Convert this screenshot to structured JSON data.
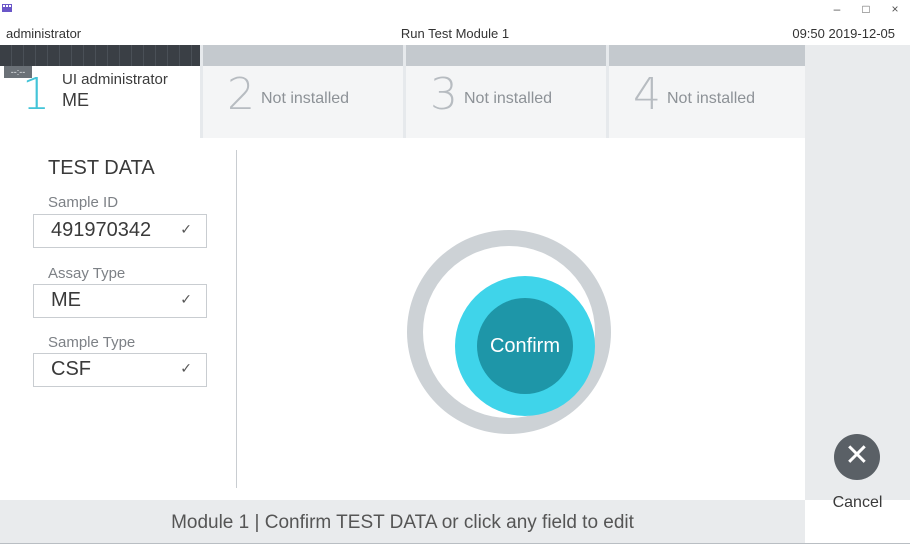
{
  "window": {
    "minimize": "–",
    "maximize": "□",
    "close": "×"
  },
  "titlebar": {
    "user": "administrator",
    "title": "Run Test Module 1",
    "datetime": "09:50 2019-12-05"
  },
  "tabs": [
    {
      "number": "1",
      "user_prefix": "UI",
      "user": "administrator",
      "assay": "ME",
      "timer": "--:--"
    },
    {
      "number": "2",
      "label": "Not installed"
    },
    {
      "number": "3",
      "label": "Not installed"
    },
    {
      "number": "4",
      "label": "Not installed"
    }
  ],
  "test_data": {
    "title": "TEST DATA",
    "fields": [
      {
        "label": "Sample ID",
        "value": "491970342"
      },
      {
        "label": "Assay Type",
        "value": "ME"
      },
      {
        "label": "Sample Type",
        "value": "CSF"
      }
    ]
  },
  "confirm_label": "Confirm",
  "cancel_label": "Cancel",
  "status": "Module 1  |  Confirm TEST DATA or click any field to edit",
  "colors": {
    "accent": "#3fd4ea",
    "confirm": "#1e96a8",
    "cancel": "#5a6066"
  }
}
